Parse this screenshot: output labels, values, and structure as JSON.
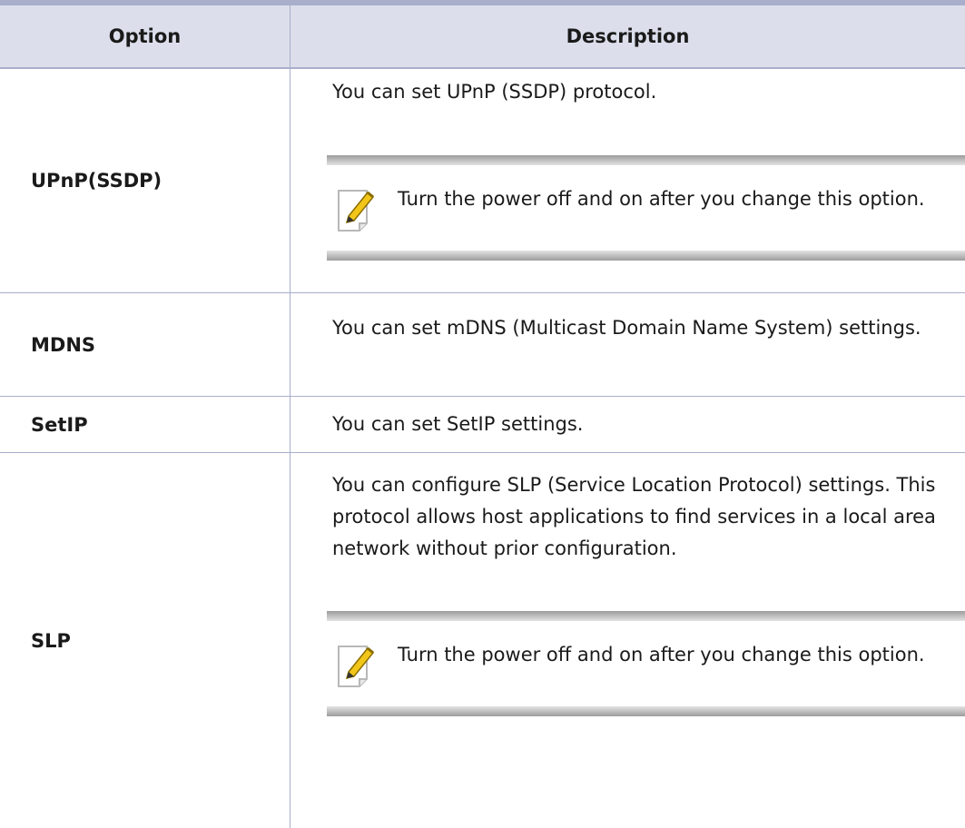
{
  "header": {
    "option": "Option",
    "description": "Description"
  },
  "rows": [
    {
      "option": "UPnP(SSDP)",
      "description": "You can set UPnP (SSDP) protocol.",
      "note": "Turn the power off and on after you change this option."
    },
    {
      "option": "MDNS",
      "description": "You can set mDNS (Multicast Domain Name System) settings."
    },
    {
      "option": "SetIP",
      "description": "You can set SetIP settings."
    },
    {
      "option": "SLP",
      "description": "You can configure SLP (Service Location Protocol) settings. This protocol allows host applications to find services in a local area network without prior configuration.",
      "note": "Turn the power off and on after you change this option."
    }
  ],
  "icons": {
    "note": "note-pencil-icon"
  },
  "colors": {
    "rule": "#a9aecb",
    "header_bg": "#dcdfeb",
    "note_bar_dark": "#9c9c9c",
    "note_bar_light": "#e3e3e3",
    "pencil_yellow": "#f2c618"
  }
}
